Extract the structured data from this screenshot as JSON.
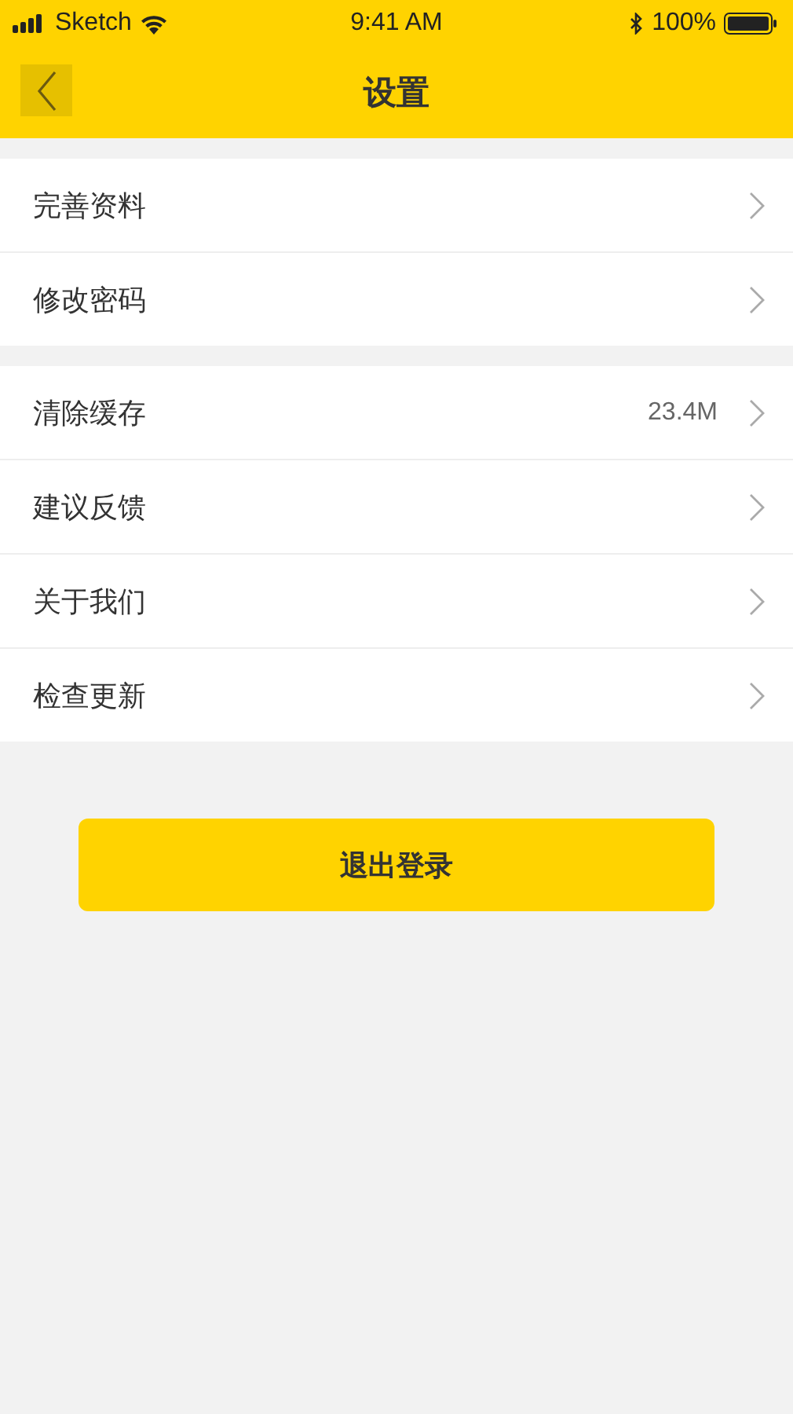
{
  "status_bar": {
    "carrier": "Sketch",
    "time": "9:41 AM",
    "battery": "100%"
  },
  "nav": {
    "title": "设置"
  },
  "groups": [
    [
      {
        "label": "完善资料"
      },
      {
        "label": "修改密码"
      }
    ],
    [
      {
        "label": "清除缓存",
        "value": "23.4M"
      },
      {
        "label": "建议反馈"
      },
      {
        "label": "关于我们"
      },
      {
        "label": "检查更新"
      }
    ]
  ],
  "logout_button": "退出登录"
}
